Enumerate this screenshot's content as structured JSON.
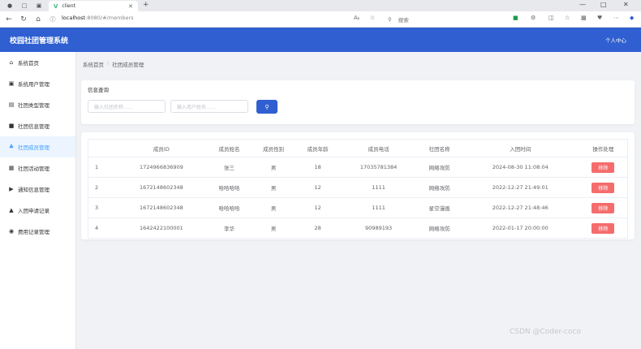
{
  "browser": {
    "tab_title": "client",
    "url_host": "localhost",
    "url_path": ":8080/#/members",
    "search_placeholder": "搜索",
    "reader_label": "Aᴀ"
  },
  "header": {
    "title": "校园社团管理系统",
    "user_label": "个人中心"
  },
  "sidebar": {
    "items": [
      {
        "label": "系统首页",
        "icon": "home-icon"
      },
      {
        "label": "系统用户管理",
        "icon": "user-icon"
      },
      {
        "label": "社团类型管理",
        "icon": "list-icon"
      },
      {
        "label": "社团信息管理",
        "icon": "info-icon"
      },
      {
        "label": "社团成员管理",
        "icon": "members-icon",
        "active": true
      },
      {
        "label": "社团活动管理",
        "icon": "activity-icon"
      },
      {
        "label": "通知信息管理",
        "icon": "notice-icon"
      },
      {
        "label": "入团申请记录",
        "icon": "apply-icon"
      },
      {
        "label": "费用记录管理",
        "icon": "fee-icon"
      }
    ]
  },
  "breadcrumb": {
    "home": "系统首页",
    "separator": "/",
    "current": "社团成员管理"
  },
  "search": {
    "title": "信息查询",
    "club_placeholder": "输入社团名称……",
    "user_placeholder": "输入用户姓名……"
  },
  "table": {
    "headers": [
      "",
      "成员ID",
      "成员姓名",
      "成员性别",
      "成员年龄",
      "成员电话",
      "社团名称",
      "入团时间",
      "操作处理"
    ],
    "rows": [
      {
        "idx": "1",
        "id": "1724966836909",
        "name": "张三",
        "gender": "男",
        "age": "18",
        "phone": "17035781384",
        "club": "网络攻防",
        "time": "2024-08-30 11:08:04"
      },
      {
        "idx": "2",
        "id": "1672148602348",
        "name": "哈哈哈哈",
        "gender": "男",
        "age": "12",
        "phone": "1111",
        "club": "网络攻防",
        "time": "2022-12-27 21:49:01"
      },
      {
        "idx": "3",
        "id": "1672148602348",
        "name": "哈哈哈哈",
        "gender": "男",
        "age": "12",
        "phone": "1111",
        "club": "星空漫画",
        "time": "2022-12-27 21:48:46"
      },
      {
        "idx": "4",
        "id": "1642422100001",
        "name": "李华",
        "gender": "男",
        "age": "28",
        "phone": "90989193",
        "club": "网络攻防",
        "time": "2022-01-17 20:00:00"
      }
    ],
    "delete_label": "移除"
  },
  "watermark": "CSDN @Coder-coco",
  "colors": {
    "primary": "#2f5fd0",
    "danger": "#f56c6c",
    "active_bg": "#ecf5ff",
    "active_text": "#409eff"
  }
}
